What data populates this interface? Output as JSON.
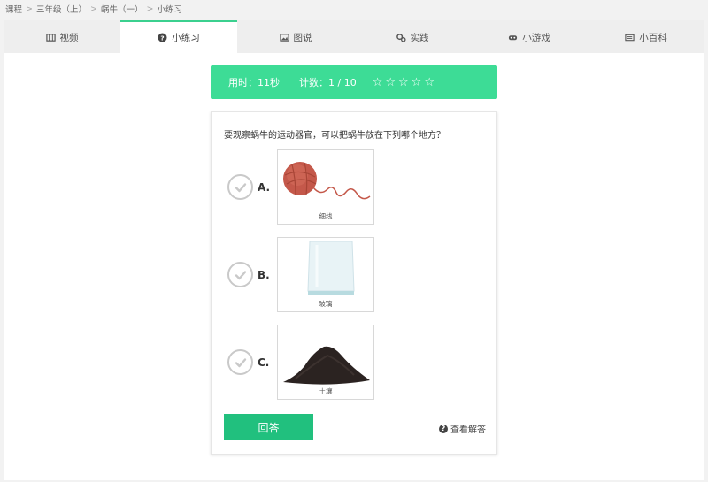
{
  "breadcrumb": [
    "课程",
    "三年级（上）",
    "蜗牛（一）",
    "小练习"
  ],
  "tabs": [
    {
      "label": "视频",
      "icon": "film-icon"
    },
    {
      "label": "小练习",
      "icon": "question-circle-icon"
    },
    {
      "label": "图说",
      "icon": "image-icon"
    },
    {
      "label": "实践",
      "icon": "gears-icon"
    },
    {
      "label": "小游戏",
      "icon": "gamepad-icon"
    },
    {
      "label": "小百科",
      "icon": "newspaper-icon"
    }
  ],
  "active_tab": "小练习",
  "status": {
    "time": "用时：11秒",
    "count": "计数：1 / 10",
    "stars": 5
  },
  "question": "要观察蜗牛的运动器官，可以把蜗牛放在下列哪个地方？",
  "options": [
    {
      "letter": "A.",
      "caption": "细线",
      "icon": "ball-of-yarn"
    },
    {
      "letter": "B.",
      "caption": "玻璃",
      "icon": "glass-plate"
    },
    {
      "letter": "C.",
      "caption": "土壤",
      "icon": "soil-pile"
    }
  ],
  "answer_button": "回答",
  "view_solution": "查看解答",
  "colors": {
    "accent": "#3ddc96",
    "button": "#21c07e",
    "tab_border": "#3bd08f"
  }
}
